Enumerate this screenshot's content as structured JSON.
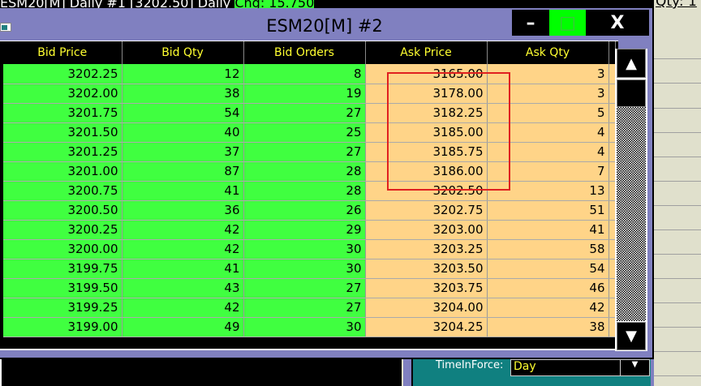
{
  "background": {
    "top_text": "ESM20[M] Daily #1 [3202.50] Daily",
    "top_chg": "Chg: 15.750",
    "qty": "Qty: 1"
  },
  "window": {
    "title": "ESM20[M]  #2",
    "minimize": "–",
    "maximize": "□",
    "close": "X",
    "maximize_color": "#00ff00"
  },
  "columns": [
    "Bid Price",
    "Bid Qty",
    "Bid Orders",
    "Ask Price",
    "Ask Qty"
  ],
  "rows": [
    [
      "3202.25",
      "12",
      "8",
      "3165.00",
      "3"
    ],
    [
      "3202.00",
      "38",
      "19",
      "3178.00",
      "3"
    ],
    [
      "3201.75",
      "54",
      "27",
      "3182.25",
      "5"
    ],
    [
      "3201.50",
      "40",
      "25",
      "3185.00",
      "4"
    ],
    [
      "3201.25",
      "37",
      "27",
      "3185.75",
      "4"
    ],
    [
      "3201.00",
      "87",
      "28",
      "3186.00",
      "7"
    ],
    [
      "3200.75",
      "41",
      "28",
      "3202.50",
      "13"
    ],
    [
      "3200.50",
      "36",
      "26",
      "3202.75",
      "51"
    ],
    [
      "3200.25",
      "42",
      "29",
      "3203.00",
      "41"
    ],
    [
      "3200.00",
      "42",
      "30",
      "3203.25",
      "58"
    ],
    [
      "3199.75",
      "41",
      "30",
      "3203.50",
      "54"
    ],
    [
      "3199.50",
      "43",
      "27",
      "3203.75",
      "46"
    ],
    [
      "3199.25",
      "42",
      "27",
      "3204.00",
      "42"
    ],
    [
      "3199.00",
      "49",
      "30",
      "3204.25",
      "38"
    ]
  ],
  "highlight": {
    "column": "Ask Price",
    "rows": "1-6",
    "color": "#e02020"
  },
  "colors": {
    "bid": "#40ff40",
    "ask": "#ffd488",
    "header_text": "#ffff30"
  },
  "order_panel": {
    "tif_label": "TimeInForce:",
    "tif_value": "Day"
  }
}
